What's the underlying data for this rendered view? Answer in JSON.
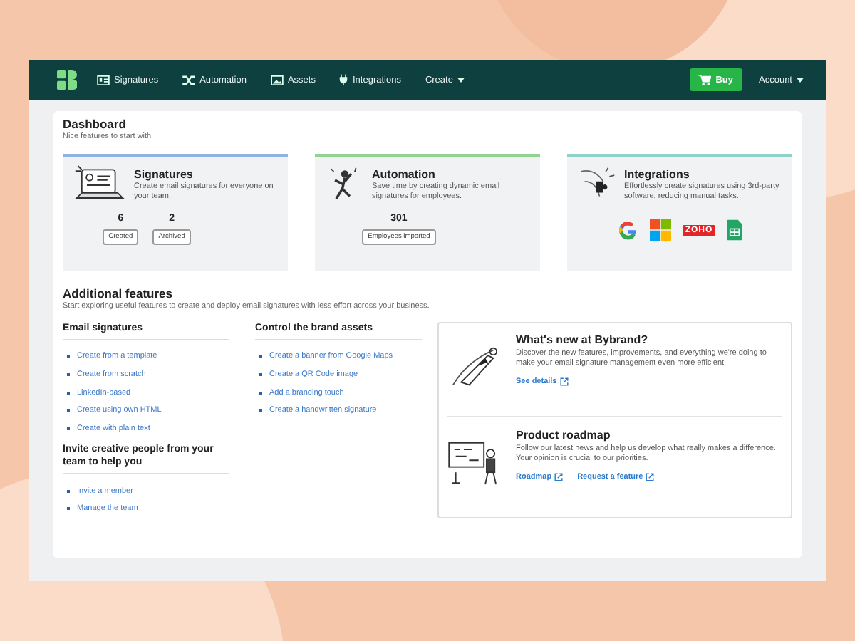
{
  "nav": {
    "items": [
      {
        "label": "Signatures",
        "kind": "card"
      },
      {
        "label": "Automation",
        "kind": "shuffle"
      },
      {
        "label": "Assets",
        "kind": "image"
      },
      {
        "label": "Integrations",
        "kind": "plug"
      }
    ],
    "create": "Create",
    "buy": "Buy",
    "account": "Account"
  },
  "dashboard": {
    "title": "Dashboard",
    "subtitle": "Nice features to start with.",
    "cards": [
      {
        "kind": "signatures",
        "title": "Signatures",
        "description": "Create email signatures for everyone on your team.",
        "color": "#8fb3e3",
        "stats": [
          {
            "value": "6",
            "label": "Created"
          },
          {
            "value": "2",
            "label": "Archived"
          }
        ]
      },
      {
        "kind": "automation",
        "title": "Automation",
        "description": "Save time by creating dynamic email signatures for employees.",
        "color": "#8fd48f",
        "stats": [
          {
            "value": "301",
            "label": "Employees imported"
          }
        ]
      },
      {
        "kind": "integrations",
        "title": "Integrations",
        "description": "Effortlessly create signatures using 3rd-party software, reducing manual tasks.",
        "color": "#8fd0c8",
        "logos": [
          {
            "kind": "google"
          },
          {
            "kind": "microsoft"
          },
          {
            "kind": "zoho",
            "label": "ZOHO"
          },
          {
            "kind": "sheets"
          }
        ]
      }
    ]
  },
  "additional": {
    "title": "Additional features",
    "subtitle": "Start exploring useful features to create and deploy email signatures with less effort across your business.",
    "columns": [
      [
        {
          "heading": "Email signatures",
          "links": [
            "Create from a template",
            "Create from scratch",
            "LinkedIn-based",
            "Create using own HTML",
            "Create with plain text"
          ]
        },
        {
          "heading": "Invite creative people from your team to help you",
          "links": [
            "Invite a member",
            "Manage the team"
          ]
        }
      ],
      [
        {
          "heading": "Control the brand assets",
          "links": [
            "Create a banner from Google Maps",
            "Create a QR Code image",
            "Add a branding touch",
            "Create a handwritten signature"
          ]
        }
      ]
    ],
    "news": [
      {
        "kind": "rocket",
        "title": "What's new at Bybrand?",
        "description": "Discover the new features, improvements, and everything we're doing to make your email signature management even more efficient.",
        "links": [
          "See details"
        ]
      },
      {
        "kind": "board",
        "title": "Product roadmap",
        "description": "Follow our latest news and help us develop what really makes a difference. Your opinion is crucial to our priorities.",
        "links": [
          "Roadmap",
          "Request a feature"
        ]
      }
    ]
  }
}
